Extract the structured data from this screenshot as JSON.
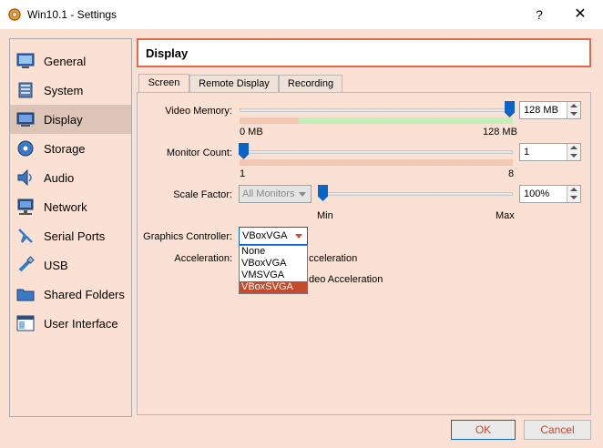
{
  "window": {
    "title": "Win10.1 - Settings",
    "help": "?",
    "close": "✕"
  },
  "sidebar": {
    "items": [
      {
        "label": "General",
        "icon": "general-icon"
      },
      {
        "label": "System",
        "icon": "system-icon"
      },
      {
        "label": "Display",
        "icon": "display-icon",
        "selected": true
      },
      {
        "label": "Storage",
        "icon": "storage-icon"
      },
      {
        "label": "Audio",
        "icon": "audio-icon"
      },
      {
        "label": "Network",
        "icon": "network-icon"
      },
      {
        "label": "Serial Ports",
        "icon": "serial-ports-icon"
      },
      {
        "label": "USB",
        "icon": "usb-icon"
      },
      {
        "label": "Shared Folders",
        "icon": "shared-folders-icon"
      },
      {
        "label": "User Interface",
        "icon": "user-interface-icon"
      }
    ]
  },
  "header": {
    "title": "Display"
  },
  "tabs": [
    {
      "label": "Screen",
      "active": true
    },
    {
      "label": "Remote Display"
    },
    {
      "label": "Recording"
    }
  ],
  "screen": {
    "video_memory": {
      "label": "Video Memory:",
      "value": "128 MB",
      "min": "0 MB",
      "max": "128 MB",
      "level": 1.0
    },
    "monitor_count": {
      "label": "Monitor Count:",
      "value": "1",
      "min": "1",
      "max": "8",
      "level": 0.0
    },
    "scale_factor": {
      "label": "Scale Factor:",
      "combo": "All Monitors",
      "value": "100%",
      "min": "Min",
      "max": "Max",
      "level": 0.0
    },
    "graphics_controller": {
      "label": "Graphics Controller:",
      "value": "VBoxVGA",
      "options": [
        "None",
        "VBoxVGA",
        "VMSVGA",
        "VBoxSVGA"
      ],
      "highlighted": "VBoxSVGA"
    },
    "acceleration": {
      "label": "Acceleration:",
      "option1_partial": "cceleration",
      "option2_partial": "deo Acceleration"
    }
  },
  "buttons": {
    "ok": "OK",
    "cancel": "Cancel"
  },
  "colors": {
    "accent": "#c64a2c",
    "selection": "#0a64c8",
    "bg": "#fbe1d3"
  }
}
